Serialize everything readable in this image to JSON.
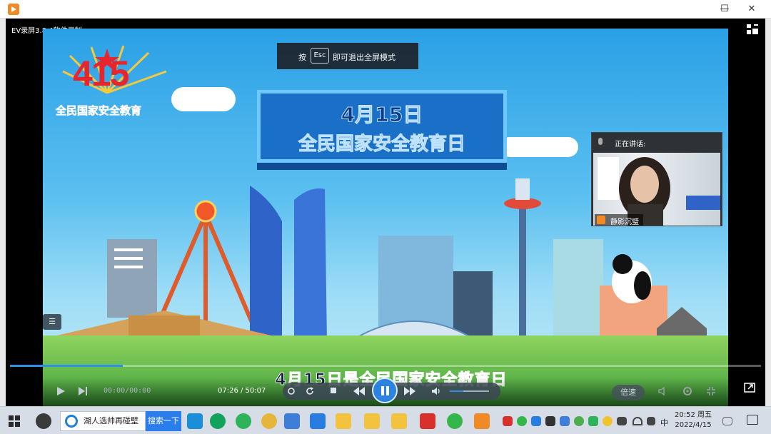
{
  "window": {
    "minimize": "—",
    "maximize": "☐",
    "close": "✕"
  },
  "player": {
    "recorder_label": "EV录屏3.8.4软件录制",
    "esc_tip": {
      "before": "按",
      "key": "Esc",
      "after": "即可退出全屏模式"
    },
    "speaker_panel": {
      "header": "正在讲话:",
      "name": "静影沉璧"
    },
    "video": {
      "logo_number": "415",
      "logo_text": "全民国家安全教育",
      "banner_line1": "4月15日",
      "banner_line2": "全民国家安全教育日",
      "caption": "4月15日是全民国家安全教育日"
    },
    "controls": {
      "left_time": "00:00/00:00",
      "current_time": "07:26 / 50:07",
      "speed_label": "倍速",
      "progress": 0.15,
      "volume": 0.35
    }
  },
  "taskbar": {
    "search_text": "湖人选帅再碰壁",
    "search_button": "搜索一下",
    "ime": "中",
    "time": "20:52 周五",
    "date": "2022/4/15"
  },
  "colors": {
    "accent": "#2f8fe8",
    "brand_orange": "#f08a24",
    "caption_red": "#e8242c"
  }
}
